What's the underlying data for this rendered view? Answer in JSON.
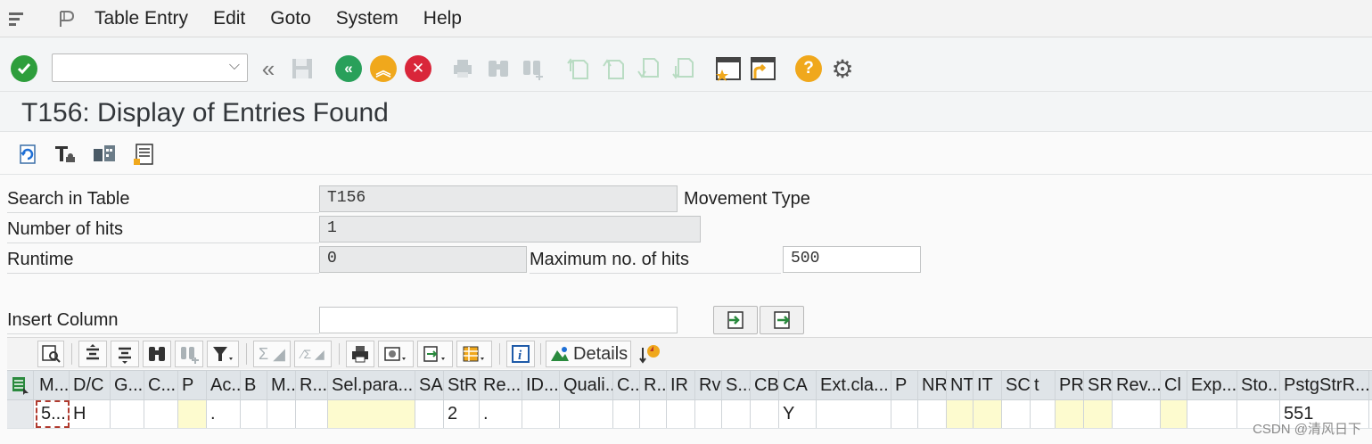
{
  "menu": {
    "items": [
      "Table Entry",
      "Edit",
      "Goto",
      "System",
      "Help"
    ]
  },
  "toolbar": {
    "command_field_value": ""
  },
  "title": "T156: Display of Entries Found",
  "form": {
    "search_in_table_label": "Search in Table",
    "search_in_table_value": "T156",
    "search_in_table_desc": "Movement Type",
    "number_of_hits_label": "Number of hits",
    "number_of_hits_value": "1",
    "runtime_label": "Runtime",
    "runtime_value": "0",
    "max_hits_label": "Maximum no. of hits",
    "max_hits_value": "500",
    "insert_column_label": "Insert Column",
    "insert_column_value": ""
  },
  "alv": {
    "details_label": "Details"
  },
  "grid": {
    "columns": [
      "M...",
      "D/C",
      "G...",
      "C...",
      "P",
      "Ac...",
      "B",
      "M...",
      "R...",
      "Sel.para...",
      "SA",
      "StR",
      "Re...",
      "ID...",
      "Quali...",
      "C...",
      "R...",
      "IR",
      "Rv",
      "S...",
      "CB",
      "CA",
      "Ext.cla...",
      "P",
      "NR",
      "NT",
      "IT",
      "SC",
      "t",
      "PR",
      "SR",
      "Rev...",
      "Cl",
      "Exp...",
      "Sto...",
      "PstgStrR..."
    ],
    "row": [
      "5...",
      "H",
      "",
      "",
      "",
      ".",
      "",
      "",
      "",
      "",
      "",
      "2",
      ".",
      "",
      "",
      "",
      "",
      "",
      "",
      "",
      "",
      "Y",
      "",
      "",
      "",
      "",
      "",
      "",
      "",
      "",
      "",
      "",
      "",
      "",
      "",
      "551"
    ]
  },
  "watermark": "CSDN @清风日下",
  "colors": {
    "check_green": "#2e9e3c",
    "back_green": "#29a05a",
    "exit_yellow": "#f0a81c",
    "cancel_red": "#d9263a",
    "help_yellow": "#f0a81c"
  }
}
